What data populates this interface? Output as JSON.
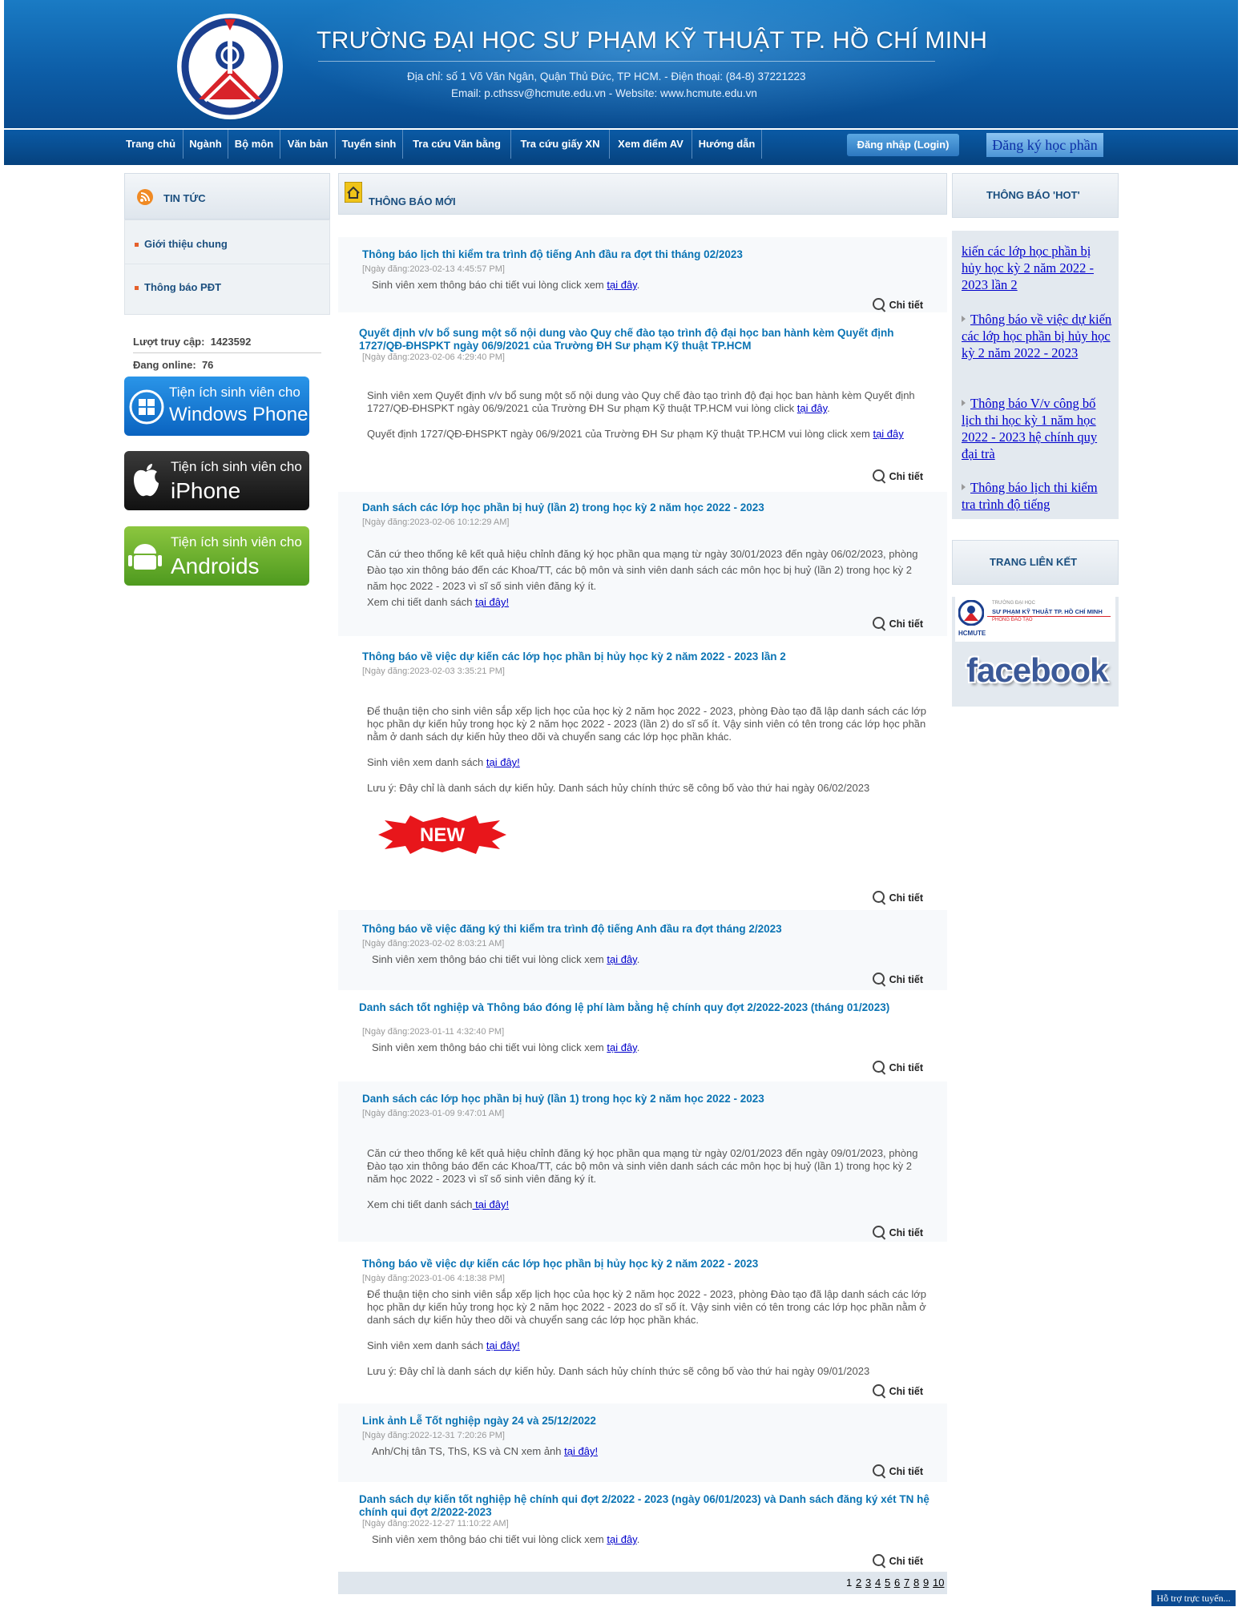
{
  "header": {
    "title": "TRƯỜNG ĐẠI HỌC SƯ PHẠM KỸ THUẬT TP. HỒ CHÍ MINH",
    "address": "Địa chỉ: số 1 Võ Văn Ngân, Quận Thủ Đức, TP HCM. - Điện thoại: (84-8) 37221223",
    "contact": "Email: p.cthssv@hcmute.edu.vn  - Website: www.hcmute.edu.vn"
  },
  "nav": {
    "items": [
      "Trang chủ",
      "Ngành",
      "Bộ môn",
      "Văn bản",
      "Tuyển sinh",
      "Tra cứu Văn bằng",
      "Tra cứu giấy XN",
      "Xem điểm AV",
      "Hướng dẫn"
    ],
    "login_label": "Đăng nhập (Login)",
    "register_label": "Đăng ký học phần"
  },
  "sidebar": {
    "news_title": "TIN TỨC",
    "links": [
      "Giới thiệu chung",
      "Thông báo PĐT"
    ],
    "visits_label": "Lượt truy cập:",
    "visits_value": "1423592",
    "online_label": "Đang online:",
    "online_value": "76",
    "apps": [
      {
        "line1": "Tiện ích sinh viên cho",
        "line2": "Windows Phone"
      },
      {
        "line1": "Tiện ích sinh viên cho",
        "line2": "iPhone"
      },
      {
        "line1": "Tiện ích sinh viên cho",
        "line2": "Androids"
      }
    ]
  },
  "main": {
    "section_title": "THÔNG BÁO MỚI",
    "detail_label": "Chi tiết",
    "new_badge": "NEW",
    "news": [
      {
        "title": "Thông báo lịch thi kiểm tra trình độ tiếng Anh đầu ra đợt thi tháng 02/2023",
        "date": "[Ngày đăng:2023-02-13 4:45:57 PM]",
        "p1": "Sinh viên xem thông báo chi tiết vui lòng click xem ",
        "link": "tại đây"
      },
      {
        "title": "Quyết định v/v bổ sung một số nội dung vào Quy chế đào tạo trình độ đại học ban hành kèm Quyết định 1727/QĐ-ĐHSPKT ngày 06/9/2021 của Trường ĐH Sư phạm Kỹ thuật TP.HCM",
        "date": "[Ngày đăng:2023-02-06 4:29:40 PM]",
        "p1": "Sinh viên xem Quyết định v/v bổ sung một số nội dung vào Quy chế đào tạo trình độ đại học ban hành kèm Quyết định 1727/QĐ-ĐHSPKT ngày 06/9/2021 của Trường ĐH Sư phạm Kỹ thuật TP.HCM vui lòng click ",
        "link": "tại đây",
        "p2": "Quyết định 1727/QĐ-ĐHSPKT ngày 06/9/2021 của Trường ĐH Sư phạm Kỹ thuật TP.HCM vui lòng click xem ",
        "link2": "tại đây"
      },
      {
        "title": "Danh sách các lớp học phần bị huỷ (lần 2) trong học kỳ 2 năm học 2022 - 2023",
        "date": "[Ngày đăng:2023-02-06 10:12:29 AM]",
        "p1": "Căn cứ theo thống kê kết quả hiệu chỉnh đăng ký học phần qua mạng từ ngày 30/01/2023 đến ngày 06/02/2023, phòng Đào tạo xin thông báo đến các Khoa/TT, các bộ môn và sinh viên danh sách các môn học bị huỷ (lần 2) trong học kỳ 2 năm học 2022 - 2023 vì sĩ số sinh viên đăng ký ít.",
        "p2": "Xem chi tiết danh sách ",
        "link2": "tại đây!"
      },
      {
        "title": "Thông báo về việc dự kiến các lớp học phần bị hủy học kỳ 2 năm 2022 - 2023 lần 2",
        "date": "[Ngày đăng:2023-02-03 3:35:21 PM]",
        "p1": "Để thuận tiện cho sinh viên sắp xếp lịch học của học kỳ 2 năm học 2022 - 2023, phòng Đào tạo đã lập danh sách các lớp học phần dự kiến hủy trong học kỳ 2 năm học 2022 - 2023 (lần 2) do sĩ số ít. Vậy sinh viên có tên trong các lớp học phần nằm ở danh sách dự kiến hủy theo dõi và chuyển sang các lớp học phần khác.",
        "p2": "Sinh viên xem danh sách ",
        "link2": "tại đây!",
        "p3": "Lưu ý: Đây chỉ là danh sách dự kiến hủy. Danh sách hủy chính thức sẽ công bố vào thứ hai ngày 06/02/2023"
      },
      {
        "title": "Thông báo về việc đăng ký thi kiểm tra trình độ tiếng Anh đầu ra đợt tháng 2/2023",
        "date": "[Ngày đăng:2023-02-02 8:03:21 AM]",
        "p1": "Sinh viên xem thông báo chi tiết vui lòng click xem ",
        "link": "tại đây"
      },
      {
        "title": "Danh sách tốt nghiệp và Thông báo đóng lệ phí làm bằng hệ chính quy đợt 2/2022-2023 (tháng 01/2023)",
        "date": "[Ngày đăng:2023-01-11 4:32:40 PM]",
        "p1": "Sinh viên xem thông báo chi tiết vui lòng click xem ",
        "link": "tại đây"
      },
      {
        "title": "Danh sách các lớp học phần bị huỷ (lần 1) trong học kỳ 2 năm học 2022 - 2023",
        "date": "[Ngày đăng:2023-01-09 9:47:01 AM]",
        "p1": "Căn cứ theo thống kê kết quả hiệu chỉnh đăng ký học phần qua mạng từ ngày 02/01/2023 đến ngày 09/01/2023, phòng Đào tạo xin thông báo đến các Khoa/TT, các bộ môn và sinh viên danh sách các môn học bị huỷ (lần 1) trong học kỳ 2 năm học 2022 - 2023 vì sĩ số sinh viên đăng ký ít.",
        "p2": "Xem chi tiết danh sách",
        "link2": " tại đây!"
      },
      {
        "title": "Thông báo về việc dự kiến các lớp học phần bị hủy học kỳ 2 năm 2022 - 2023",
        "date": "[Ngày đăng:2023-01-06 4:18:38 PM]",
        "p1": "Để thuận tiện cho sinh viên sắp xếp lịch học của học kỳ 2 năm học 2022 - 2023, phòng Đào tạo đã lập danh sách các lớp học phần dự kiến hủy trong học kỳ 2 năm học 2022 - 2023 do sĩ số ít. Vậy sinh viên có tên trong các lớp học phần nằm ở danh sách dự kiến hủy theo dõi và chuyển sang các lớp học phần khác.",
        "p2": "Sinh viên xem danh sách ",
        "link2": "tại đây!",
        "p3": "Lưu ý: Đây chỉ là danh sách dự kiến hủy. Danh sách hủy chính thức sẽ công bố vào thứ hai ngày 09/01/2023"
      },
      {
        "title": "Link ảnh Lễ Tốt nghiệp ngày 24 và 25/12/2022",
        "date": "[Ngày đăng:2022-12-31 7:20:26 PM]",
        "p1": "Anh/Chị tân TS, ThS, KS và CN xem ảnh ",
        "link": "tại đây!"
      },
      {
        "title": "Danh sách dự kiến tốt nghiệp hệ chính qui đợt 2/2022 - 2023 (ngày 06/01/2023) và Danh sách đăng ký xét TN hệ chính qui đợt 2/2022-2023",
        "date": "[Ngày đăng:2022-12-27 11:10:22 AM]",
        "p1": "Sinh viên xem thông báo chi tiết vui lòng click xem ",
        "link": "tại đây"
      }
    ],
    "pages": [
      "1",
      "2",
      "3",
      "4",
      "5",
      "6",
      "7",
      "8",
      "9",
      "10"
    ]
  },
  "right": {
    "hot_title": "THÔNG BÁO 'HOT'",
    "hot_items": [
      "kiến các lớp học phần bị hủy học kỳ 2 năm 2022 - 2023 lần 2",
      "Thông báo về việc dự kiến các lớp học phần bị hủy học kỳ 2 năm 2022 - 2023",
      "Thông báo V/v công bố lịch thi học kỳ 1 năm học 2022 - 2023 hệ chính quy đại trà",
      "Thông báo lịch thi kiểm tra trình độ tiếng"
    ],
    "links_title": "TRANG LIÊN KẾT",
    "hcmute_small": "TRƯỜNG ĐẠI HỌC",
    "hcmute_name": "SƯ PHẠM KỸ THUẬT TP. HỒ CHÍ MINH",
    "hcmute_dept": "PHÒNG ĐÀO TẠO",
    "hcmute_abbr": "HCMUTE",
    "facebook": "facebook"
  },
  "footer": {
    "support_label": "Hỗ trợ trực tuyến..."
  }
}
